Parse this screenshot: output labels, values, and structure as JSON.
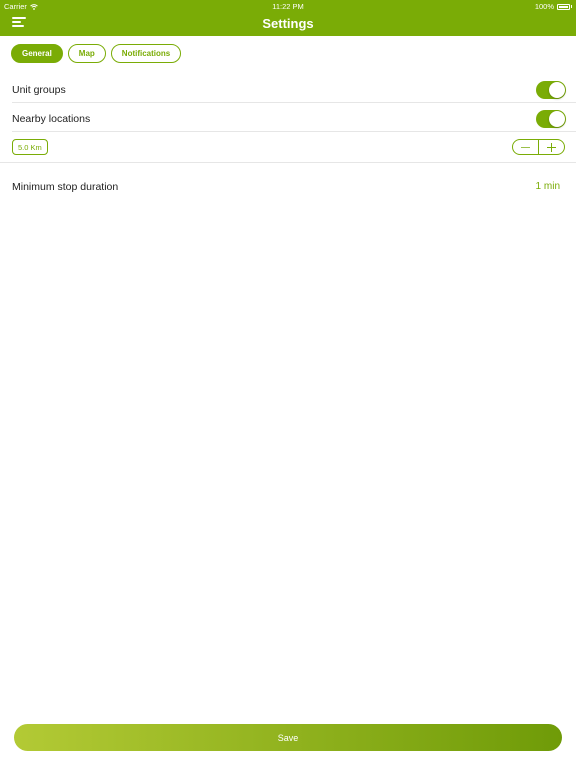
{
  "status_bar": {
    "carrier": "Carrier",
    "time": "11:22 PM",
    "battery": "100%"
  },
  "header": {
    "title": "Settings",
    "menu_icon": "menu-icon",
    "background_color": "#7aac06"
  },
  "tabs": [
    {
      "label": "General",
      "active": true
    },
    {
      "label": "Map",
      "active": false
    },
    {
      "label": "Notifications",
      "active": false
    }
  ],
  "settings": {
    "unit_groups": {
      "label": "Unit groups",
      "enabled": true
    },
    "nearby_locations": {
      "label": "Nearby locations",
      "enabled": true
    },
    "distance": {
      "value": "5.0 Km",
      "decrement_icon": "minus-icon",
      "increment_icon": "plus-icon"
    },
    "minimum_stop_duration": {
      "label": "Minimum stop duration",
      "value": "1 min"
    }
  },
  "footer": {
    "save_label": "Save"
  },
  "colors": {
    "accent": "#7aac06",
    "save_gradient_start": "#b3ca35",
    "save_gradient_end": "#6f9b08"
  }
}
